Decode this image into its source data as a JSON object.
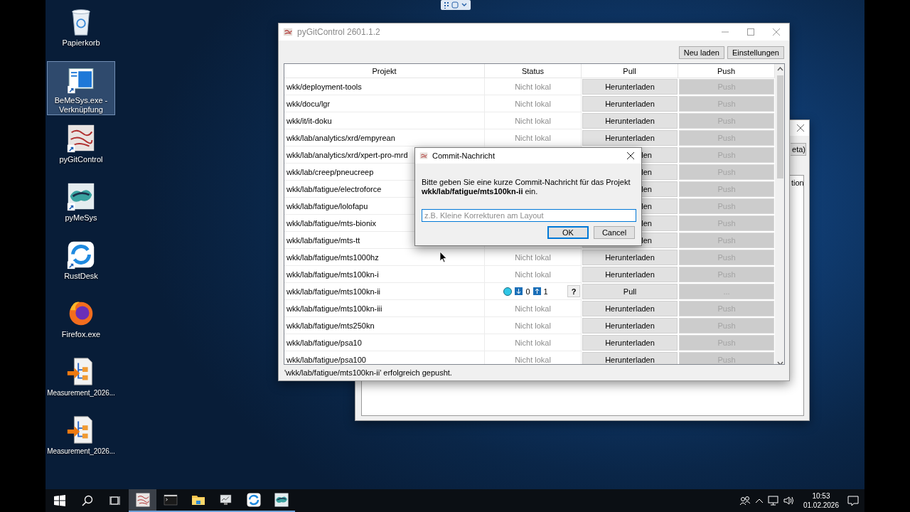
{
  "desktop_icons": [
    {
      "label": "Papierkorb",
      "kind": "recycle",
      "shortcut": false,
      "selected": false
    },
    {
      "label": "BeMeSys.exe - Verknüpfung",
      "kind": "window",
      "shortcut": true,
      "selected": true
    },
    {
      "label": "pyGitControl",
      "kind": "sketch",
      "shortcut": true,
      "selected": false
    },
    {
      "label": "pyMeSys",
      "kind": "graffiti",
      "shortcut": true,
      "selected": false
    },
    {
      "label": "RustDesk",
      "kind": "ring",
      "shortcut": true,
      "selected": false
    },
    {
      "label": "Firefox.exe",
      "kind": "fox",
      "shortcut": false,
      "selected": false
    },
    {
      "label": "Measurement_2026...",
      "kind": "flow",
      "shortcut": false,
      "selected": false
    },
    {
      "label": "Measurement_2026...",
      "kind": "flow",
      "shortcut": false,
      "selected": false
    }
  ],
  "background_window": {
    "button_fragment": "eta)",
    "label_fragment": "tion"
  },
  "main_window": {
    "title": "pyGitControl 2601.1.2",
    "toolbar_buttons": [
      "Neu laden",
      "Einstellungen"
    ],
    "table": {
      "columns": [
        "Projekt",
        "Status",
        "Pull",
        "Push"
      ],
      "rows": [
        {
          "kind": "remote",
          "project": "wkk/deployment-tools",
          "status": "Nicht lokal",
          "pull": "Herunterladen",
          "push": {
            "label": "Push",
            "disabled": true
          }
        },
        {
          "kind": "remote",
          "project": "wkk/docu/lgr",
          "status": "Nicht lokal",
          "pull": "Herunterladen",
          "push": {
            "label": "Push",
            "disabled": true
          }
        },
        {
          "kind": "remote",
          "project": "wkk/it/it-doku",
          "status": "Nicht lokal",
          "pull": "Herunterladen",
          "push": {
            "label": "Push",
            "disabled": true
          }
        },
        {
          "kind": "remote",
          "project": "wkk/lab/analytics/xrd/empyrean",
          "status": "Nicht lokal",
          "pull": "Herunterladen",
          "push": {
            "label": "Push",
            "disabled": true
          }
        },
        {
          "kind": "covered",
          "project": "wkk/lab/analytics/xrd/xpert-pro-mrd",
          "pull": "len",
          "push": {
            "label": "Push",
            "disabled": true
          }
        },
        {
          "kind": "covered",
          "project": "wkk/lab/creep/pneucreep",
          "pull": "len",
          "push": {
            "label": "Push",
            "disabled": true
          }
        },
        {
          "kind": "covered",
          "project": "wkk/lab/fatigue/electroforce",
          "pull": "len",
          "push": {
            "label": "Push",
            "disabled": true
          }
        },
        {
          "kind": "covered",
          "project": "wkk/lab/fatigue/lolofapu",
          "pull": "len",
          "push": {
            "label": "Push",
            "disabled": true
          }
        },
        {
          "kind": "covered",
          "project": "wkk/lab/fatigue/mts-bionix",
          "pull": "len",
          "push": {
            "label": "Push",
            "disabled": true
          }
        },
        {
          "kind": "covered",
          "project": "wkk/lab/fatigue/mts-tt",
          "pull": "len",
          "push": {
            "label": "Push",
            "disabled": true
          }
        },
        {
          "kind": "remote",
          "project": "wkk/lab/fatigue/mts1000hz",
          "status": "Nicht lokal",
          "pull": "Herunterladen",
          "push": {
            "label": "Push",
            "disabled": true
          }
        },
        {
          "kind": "remote",
          "project": "wkk/lab/fatigue/mts100kn-i",
          "status": "Nicht lokal",
          "pull": "Herunterladen",
          "push": {
            "label": "Push",
            "disabled": true
          }
        },
        {
          "kind": "local",
          "project": "wkk/lab/fatigue/mts100kn-ii",
          "behind": "0",
          "ahead": "1",
          "help": "?",
          "pull": "Pull",
          "push": {
            "label": "...",
            "disabled": true
          }
        },
        {
          "kind": "remote",
          "project": "wkk/lab/fatigue/mts100kn-iii",
          "status": "Nicht lokal",
          "pull": "Herunterladen",
          "push": {
            "label": "Push",
            "disabled": true
          }
        },
        {
          "kind": "remote",
          "project": "wkk/lab/fatigue/mts250kn",
          "status": "Nicht lokal",
          "pull": "Herunterladen",
          "push": {
            "label": "Push",
            "disabled": true
          }
        },
        {
          "kind": "remote",
          "project": "wkk/lab/fatigue/psa10",
          "status": "Nicht lokal",
          "pull": "Herunterladen",
          "push": {
            "label": "Push",
            "disabled": true
          }
        },
        {
          "kind": "remote",
          "project": "wkk/lab/fatigue/psa100",
          "status": "Nicht lokal",
          "pull": "Herunterladen",
          "push": {
            "label": "Push",
            "disabled": true
          }
        }
      ]
    },
    "status_bar": "'wkk/lab/fatigue/mts100kn-ii' erfolgreich gepusht."
  },
  "dialog": {
    "title": "Commit-Nachricht",
    "message": "Bitte geben Sie eine kurze Commit-Nachricht für das Projekt **wkk/lab/fatigue/mts100kn-ii** ein.",
    "placeholder": "z.B. Kleine Korrekturen am Layout",
    "buttons": [
      {
        "label": "OK",
        "default": true
      },
      {
        "label": "Cancel",
        "default": false
      }
    ]
  },
  "taskbar": {
    "apps": [
      {
        "kind": "sketch",
        "active": true
      },
      {
        "kind": "terminal",
        "active": false
      },
      {
        "kind": "folder",
        "active": false
      },
      {
        "kind": "monitor",
        "active": false
      },
      {
        "kind": "ring",
        "active": false
      },
      {
        "kind": "graffiti",
        "active": false
      }
    ],
    "time": "10:53",
    "date": "01.02.2026"
  }
}
